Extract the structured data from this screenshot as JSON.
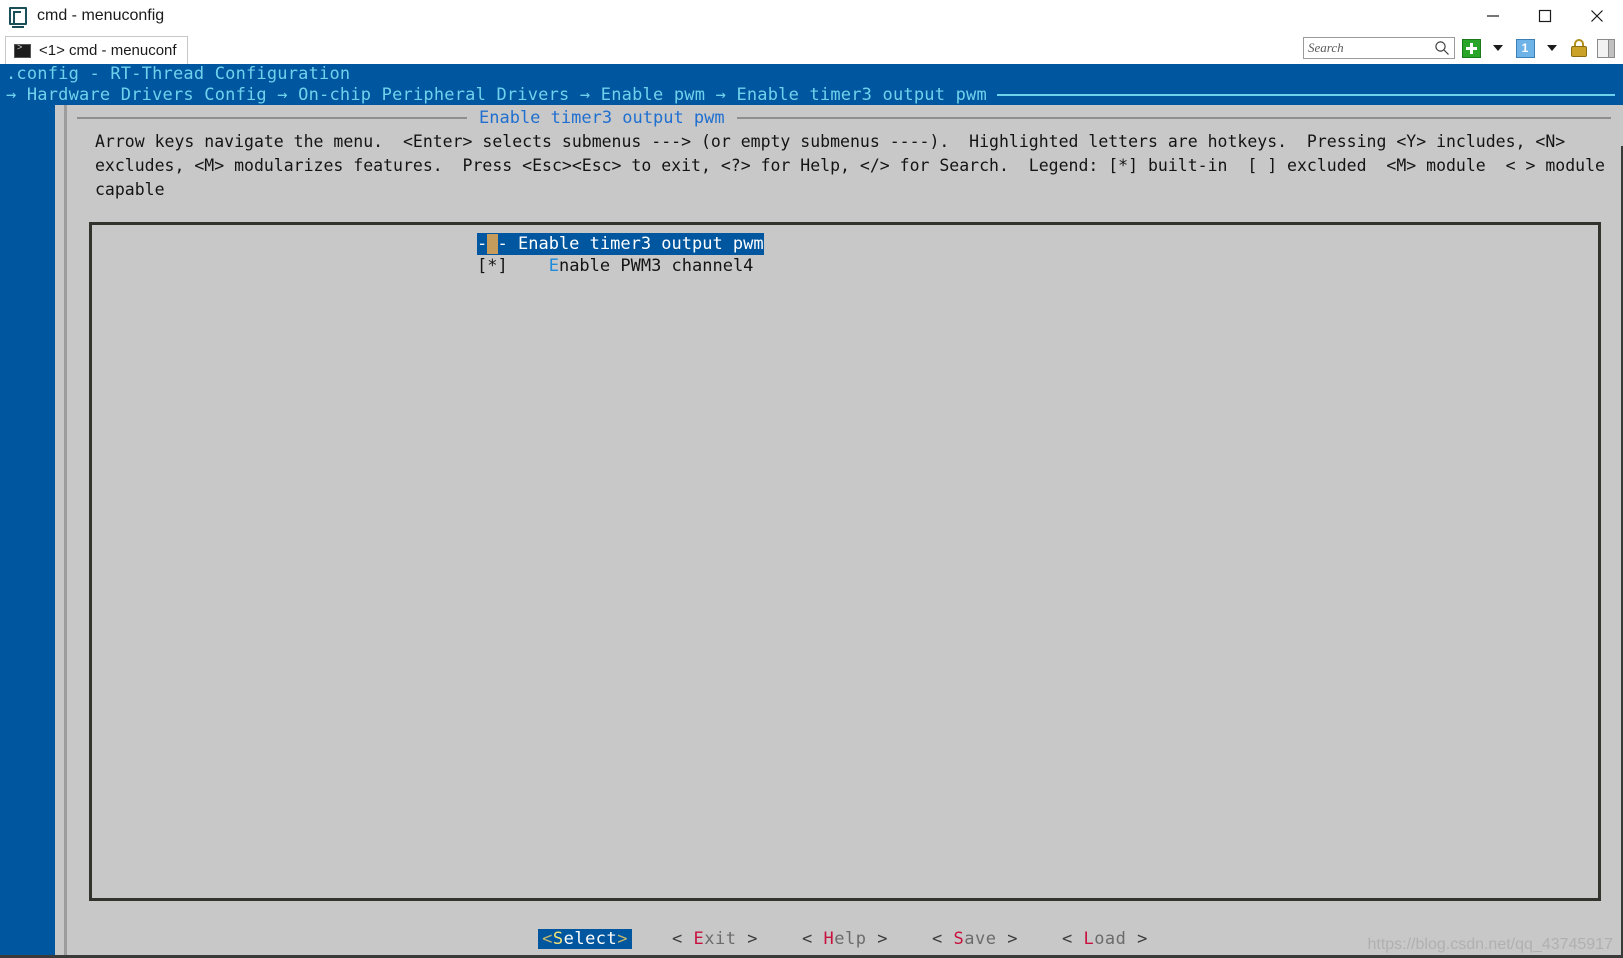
{
  "window": {
    "title": "cmd - menuconfig",
    "icon": "console-app-icon",
    "controls": {
      "minimize": "minimize-icon",
      "maximize": "maximize-icon",
      "close": "close-icon"
    }
  },
  "tabstrip": {
    "tab": {
      "label": "<1> cmd - menuconf",
      "icon": "console-icon"
    },
    "toolbar": {
      "search": {
        "placeholder": "Search",
        "value": "Search",
        "icon": "magnifier-icon"
      },
      "new_tab": {
        "icon": "green-plus-icon",
        "label": "+"
      },
      "new_tab_dropdown": {
        "icon": "chevron-down-icon"
      },
      "pane_one": {
        "icon": "pane-one-icon",
        "label": "1"
      },
      "pane_dropdown": {
        "icon": "chevron-down-icon"
      },
      "lock": {
        "icon": "lock-icon"
      },
      "layout": {
        "icon": "split-panel-icon"
      }
    }
  },
  "menuconfig": {
    "header": {
      "config_title": ".config - RT-Thread Configuration",
      "breadcrumb_prefix": "→ ",
      "breadcrumb": "→ Hardware Drivers Config → On-chip Peripheral Drivers → Enable pwm → Enable timer3 output pwm"
    },
    "dialog_title": "Enable timer3 output pwm",
    "help_text": "Arrow keys navigate the menu.  <Enter> selects submenus ---> (or empty submenus ----).  Highlighted letters are hotkeys.  Pressing <Y> includes, <N>\nexcludes, <M> modularizes features.  Press <Esc><Esc> to exit, <?> for Help, </> for Search.  Legend: [*] built-in  [ ] excluded  <M> module  < > module\ncapable",
    "items": [
      {
        "marker_left": "-",
        "marker_mid": "*",
        "marker_right": "-",
        "gap": " ",
        "label": "Enable timer3 output pwm",
        "selected": true,
        "hotkey": ""
      },
      {
        "marker_left": "[",
        "marker_mid": "*",
        "marker_right": "]",
        "gap": "    ",
        "label_hotkey": "E",
        "label_rest": "nable PWM3 channel4",
        "selected": false
      }
    ],
    "buttons": [
      {
        "open": "<",
        "hotkey": "S",
        "rest": "elect",
        "close": ">",
        "active": true,
        "label": "<Select>"
      },
      {
        "open": "<",
        "hotkey": "E",
        "rest": "xit",
        "close": ">",
        "active": false,
        "label": "< Exit >"
      },
      {
        "open": "<",
        "hotkey": "H",
        "rest": "elp",
        "close": ">",
        "active": false,
        "label": "< Help >"
      },
      {
        "open": "<",
        "hotkey": "S",
        "rest": "ave",
        "close": ">",
        "active": false,
        "label": "< Save >"
      },
      {
        "open": "<",
        "hotkey": "L",
        "rest": "oad",
        "close": ">",
        "active": false,
        "label": "< Load >"
      }
    ]
  },
  "watermark": "https://blog.csdn.net/qq_43745917",
  "colors": {
    "terminal_bg": "#c8c8c8",
    "header_blue": "#00569f",
    "header_text": "#6fd2ec",
    "dialog_title": "#1f6fd0",
    "hotkey_blue": "#1f8bdc",
    "hotkey_red": "#c8103e",
    "star_tan": "#c69c5d",
    "panel_border": "#33332e"
  }
}
